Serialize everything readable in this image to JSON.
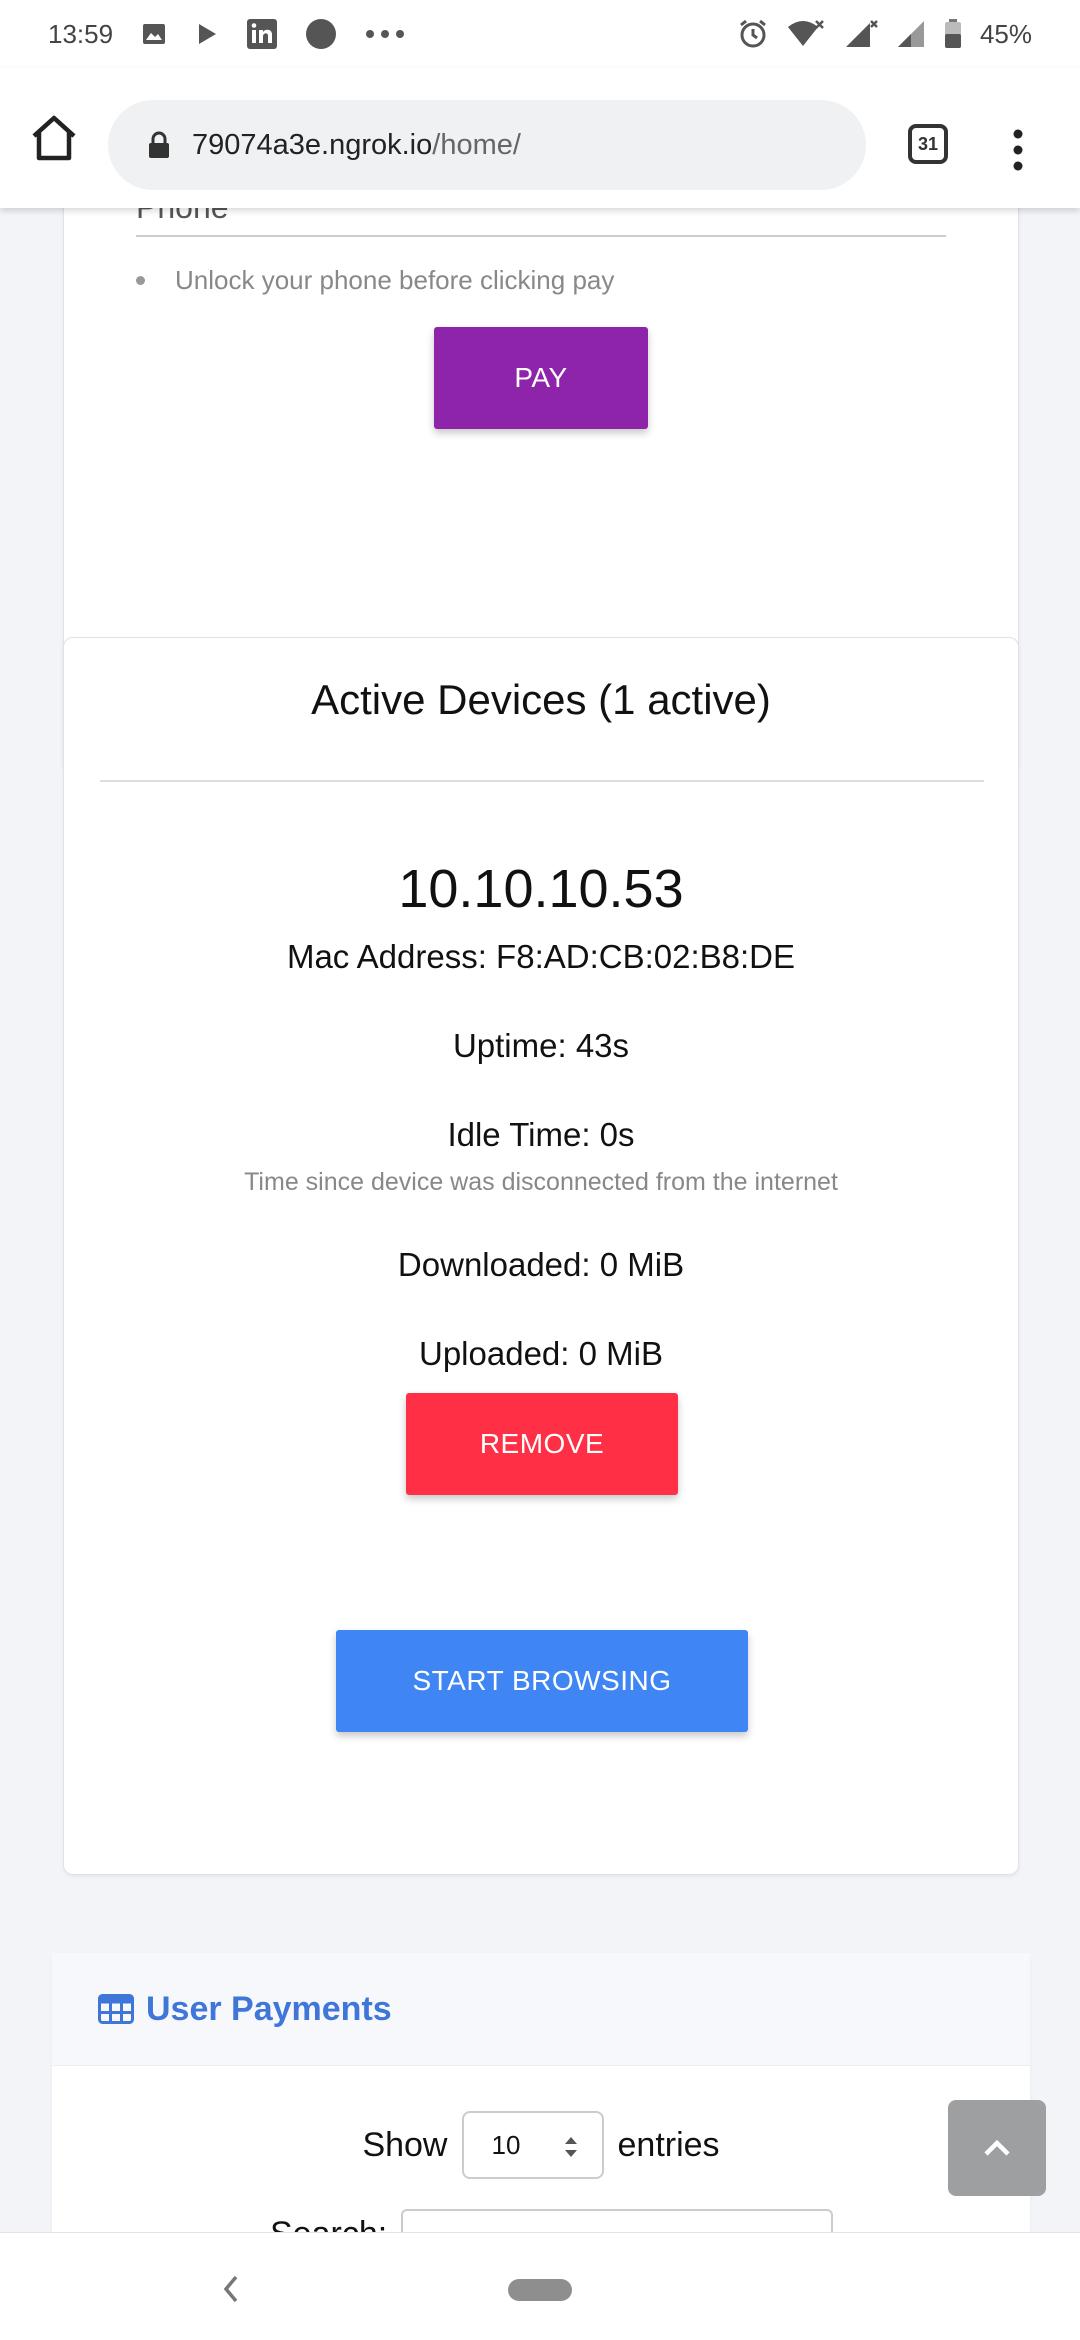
{
  "status_bar": {
    "time": "13:59",
    "battery": "45%",
    "left_icons": [
      "image-icon",
      "play-icon",
      "linkedin-icon",
      "circle-icon",
      "more-dots-icon"
    ],
    "right_icons": [
      "alarm-icon",
      "wifi-icon",
      "signal-icon",
      "signal-icon",
      "battery-icon"
    ]
  },
  "browser": {
    "url_domain": "79074a3e.ngrok.io",
    "url_path": "/home/",
    "tab_count": "31"
  },
  "payment_card": {
    "phone_label": "Phone",
    "hint": "Unlock your phone before clicking pay",
    "pay_label": "PAY",
    "pay_color": "#8e24aa"
  },
  "devices_card": {
    "title": "Active Devices (1 active)",
    "ip": "10.10.10.53",
    "mac": "Mac Address: F8:AD:CB:02:B8:DE",
    "uptime": "Uptime: 43s",
    "idle": "Idle Time: 0s",
    "idle_note": "Time since device was disconnected from the internet",
    "downloaded": "Downloaded: 0 MiB",
    "uploaded": "Uploaded: 0 MiB",
    "remove_label": "REMOVE",
    "remove_color": "#ff2f45",
    "browse_label": "START BROWSING",
    "browse_color": "#3f86f4"
  },
  "payments_card": {
    "title": "User Payments",
    "show_label": "Show",
    "entries_value": "10",
    "entries_label": "entries",
    "search_label": "Search:",
    "accent": "#3f76d8"
  }
}
